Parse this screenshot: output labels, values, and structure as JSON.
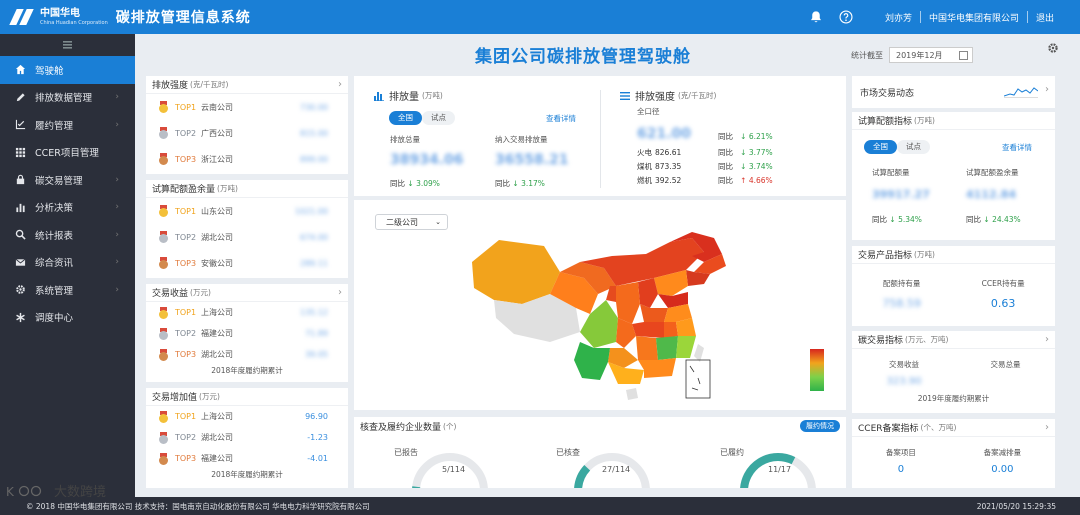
{
  "app": {
    "brand_cn": "中国华电",
    "brand_en": "China Huadian Corporation",
    "title": "碳排放管理信息系统"
  },
  "topbar": {
    "user": "刘亦芳",
    "org": "中国华电集团有限公司",
    "logout": "退出"
  },
  "sidebar": {
    "items": [
      {
        "label": "驾驶舱",
        "icon": "home-icon",
        "active": true
      },
      {
        "label": "排放数据管理",
        "icon": "pencil-icon"
      },
      {
        "label": "履约管理",
        "icon": "check-chart-icon"
      },
      {
        "label": "CCER项目管理",
        "icon": "grid-icon"
      },
      {
        "label": "碳交易管理",
        "icon": "lock-icon"
      },
      {
        "label": "分析决策",
        "icon": "bar-chart-icon"
      },
      {
        "label": "统计报表",
        "icon": "search-icon"
      },
      {
        "label": "综合资讯",
        "icon": "mail-icon"
      },
      {
        "label": "系统管理",
        "icon": "gear-icon"
      },
      {
        "label": "调度中心",
        "icon": "asterisk-icon"
      }
    ]
  },
  "dashboard": {
    "title": "集团公司碳排放管理驾驶舱",
    "stat_label": "统计截至",
    "stat_date": "2019年12月"
  },
  "rank_labels": {
    "top1": "TOP1",
    "top2": "TOP2",
    "top3": "TOP3"
  },
  "left": {
    "intensity": {
      "title": "排放强度",
      "unit": "(克/千瓦时)",
      "rows": [
        {
          "co": "云南公司",
          "val": "730.00"
        },
        {
          "co": "广西公司",
          "val": "815.00"
        },
        {
          "co": "浙江公司",
          "val": "899.00"
        }
      ]
    },
    "quota": {
      "title": "试算配额盈余量",
      "unit": "(万吨)",
      "rows": [
        {
          "co": "山东公司",
          "val": "1021.00"
        },
        {
          "co": "湖北公司",
          "val": "674.00"
        },
        {
          "co": "安徽公司",
          "val": "289.11"
        }
      ]
    },
    "income": {
      "title": "交易收益",
      "unit": "(万元)",
      "rows": [
        {
          "co": "上海公司",
          "val": "135.12"
        },
        {
          "co": "福建公司",
          "val": "71.89"
        },
        {
          "co": "湖北公司",
          "val": "39.05"
        }
      ],
      "note": "2018年度履约期累计"
    },
    "added": {
      "title": "交易增加值",
      "unit": "(万元)",
      "rows": [
        {
          "co": "上海公司",
          "val": "96.90"
        },
        {
          "co": "湖北公司",
          "val": "-1.23"
        },
        {
          "co": "福建公司",
          "val": "-4.01"
        }
      ],
      "note": "2018年度履约期累计"
    }
  },
  "emission": {
    "title": "排放量",
    "unit": "(万吨)",
    "tab_all": "全国",
    "tab_pilot": "试点",
    "detail": "查看详情",
    "total_label": "排放总量",
    "total_val": "38934.06",
    "total_pct": "3.09%",
    "incl_label": "纳入交易排放量",
    "incl_val": "36558.21",
    "incl_pct": "3.17%",
    "yoy": "同比"
  },
  "intensity_panel": {
    "title": "排放强度",
    "unit": "(克/千瓦时)",
    "scope": "全口径",
    "main_val": "621.00",
    "yoy": "同比",
    "main_pct": "6.21%",
    "rows": [
      {
        "name": "火电",
        "val": "826.61",
        "pct": "3.77%",
        "dir": "down"
      },
      {
        "name": "煤机",
        "val": "873.35",
        "pct": "3.74%",
        "dir": "down"
      },
      {
        "name": "燃机",
        "val": "392.52",
        "pct": "4.66%",
        "dir": "up"
      }
    ]
  },
  "map": {
    "select": "二级公司"
  },
  "bottom": {
    "title": "核查及履约企业数量",
    "unit": "(个)",
    "button": "履约情况",
    "gauges": [
      {
        "label": "已报告",
        "val": "5/114",
        "frac": 0.04
      },
      {
        "label": "已核查",
        "val": "27/114",
        "frac": 0.24
      },
      {
        "label": "已履约",
        "val": "11/17",
        "frac": 0.65
      }
    ]
  },
  "right": {
    "market": {
      "title": "市场交易动态"
    },
    "trial": {
      "title": "试算配额指标",
      "unit": "(万吨)",
      "tab_all": "全国",
      "tab_pilot": "试点",
      "detail": "查看详情",
      "q_label": "试算配额量",
      "q_val": "39917.27",
      "q_pct": "5.34%",
      "s_label": "试算配额盈余量",
      "s_val": "4112.84",
      "s_pct": "24.43%",
      "yoy": "同比"
    },
    "product": {
      "title": "交易产品指标",
      "unit": "(万吨)",
      "a_label": "配额持有量",
      "a_val": "758.59",
      "b_label": "CCER持有量",
      "b_val": "0.63"
    },
    "carbon": {
      "title": "碳交易指标",
      "unit": "(万元、万吨)",
      "a_label": "交易收益",
      "a_val": "323.90",
      "b_label": "交易总量",
      "b_val": "",
      "note": "2019年度履约期累计"
    },
    "ccer": {
      "title": "CCER备案指标",
      "unit": "(个、万吨)",
      "a_label": "备案项目",
      "a_val": "0",
      "b_label": "备案减排量",
      "b_val": "0.00"
    }
  },
  "footer": {
    "copyright": "© 2018 中国华电集团有限公司 技术支持：国电南京自动化股份有限公司 华电电力科学研究院有限公司",
    "time": "2021/05/20 15:29:35"
  },
  "watermark": {
    "text": "大数跨境"
  },
  "colors": {
    "primary": "#1a7fd6",
    "sidebar": "#2b2f3a",
    "up": "#d9352b",
    "down": "#2ea04a"
  }
}
